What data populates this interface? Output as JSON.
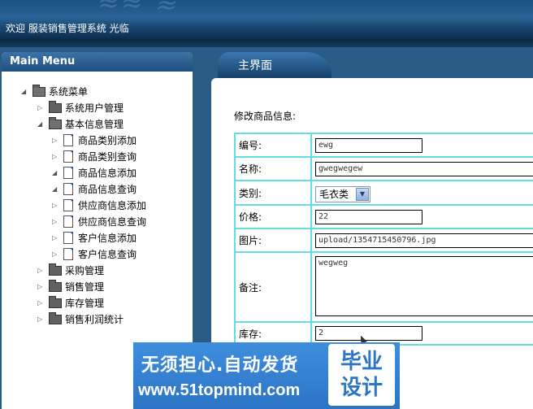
{
  "header": {
    "welcome": "欢迎 服装销售管理系统 光临"
  },
  "sidebar": {
    "title": "Main Menu",
    "tree": [
      {
        "label": "系统菜单",
        "type": "folder",
        "level": 0,
        "expanded": true
      },
      {
        "label": "系统用户管理",
        "type": "folder",
        "level": 1,
        "expanded": false
      },
      {
        "label": "基本信息管理",
        "type": "folder",
        "level": 1,
        "expanded": true
      },
      {
        "label": "商品类别添加",
        "type": "doc",
        "level": 2
      },
      {
        "label": "商品类别查询",
        "type": "doc",
        "level": 2
      },
      {
        "label": "商品信息添加",
        "type": "doc",
        "level": 2
      },
      {
        "label": "商品信息查询",
        "type": "doc",
        "level": 2
      },
      {
        "label": "供应商信息添加",
        "type": "doc",
        "level": 2
      },
      {
        "label": "供应商信息查询",
        "type": "doc",
        "level": 2
      },
      {
        "label": "客户信息添加",
        "type": "doc",
        "level": 2
      },
      {
        "label": "客户信息查询",
        "type": "doc",
        "level": 2
      },
      {
        "label": "采购管理",
        "type": "folder",
        "level": 1,
        "expanded": false
      },
      {
        "label": "销售管理",
        "type": "folder",
        "level": 1,
        "expanded": false
      },
      {
        "label": "库存管理",
        "type": "folder",
        "level": 1,
        "expanded": false
      },
      {
        "label": "销售利润统计",
        "type": "folder",
        "level": 1,
        "expanded": false
      }
    ]
  },
  "main": {
    "tab_label": "主界面",
    "form_title": "修改商品信息:",
    "fields": {
      "code": {
        "label": "编号:",
        "value": "ewg"
      },
      "name": {
        "label": "名称:",
        "value": "gwegwegew"
      },
      "category": {
        "label": "类别:",
        "value": "毛衣类"
      },
      "price": {
        "label": "价格:",
        "value": "22"
      },
      "image": {
        "label": "图片:",
        "value": "upload/1354715450796.jpg"
      },
      "remark": {
        "label": "备注:",
        "value": "wegweg"
      },
      "stock": {
        "label": "库存:",
        "value": "2"
      }
    }
  },
  "watermark": {
    "line1": "无须担心.自动发货",
    "line2": "www.51topmind.com",
    "badge_line1": "毕业",
    "badge_line2": "设计"
  }
}
